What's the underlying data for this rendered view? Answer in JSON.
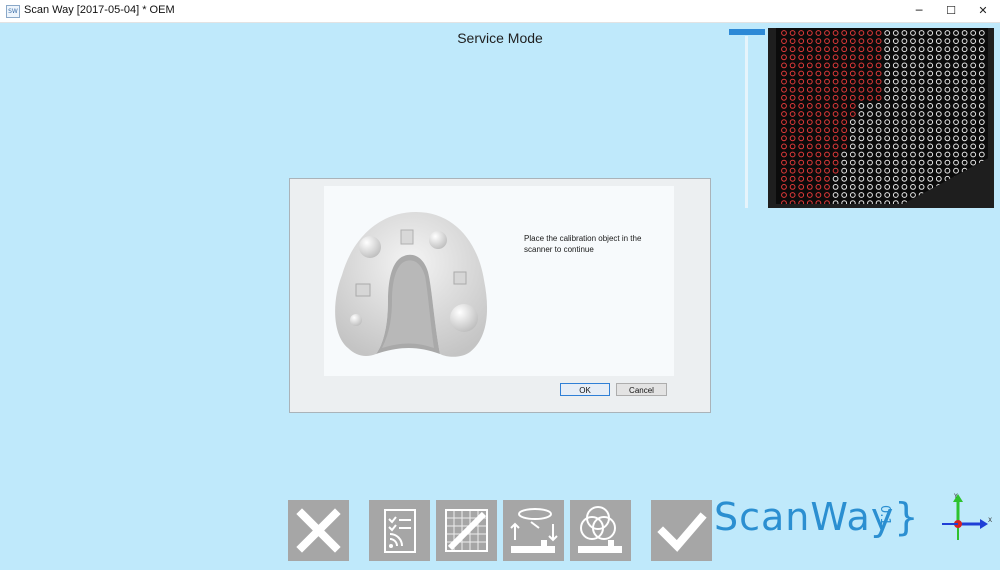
{
  "window": {
    "icon_text": "SW",
    "title": "Scan Way [2017-05-04]  * OEM",
    "minimize": "─",
    "maximize": "☐",
    "close": "✕"
  },
  "header": {
    "title": "Service Mode"
  },
  "dialog": {
    "message": "Place the calibration object in the scanner to continue",
    "ok_label": "OK",
    "cancel_label": "Cancel"
  },
  "toolbar": {
    "icons": [
      "close-icon",
      "checklist-icon",
      "calibration-grid-icon",
      "scale-arrows-icon",
      "color-circles-icon",
      "checkmark-icon"
    ]
  },
  "logo": {
    "text": "ScanWay}",
    "sub": "0.1"
  },
  "axes": {
    "y_label": "Y",
    "x_label": "X"
  },
  "colors": {
    "background": "#bfe9fb",
    "accent": "#2d89d6",
    "button_gray": "#a6a6a6"
  }
}
